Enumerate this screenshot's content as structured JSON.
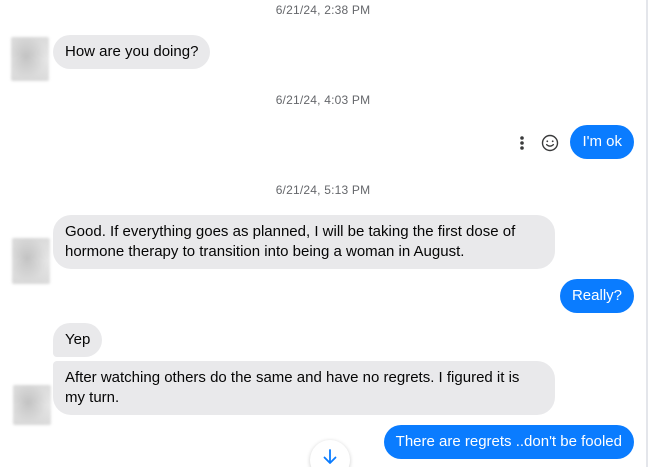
{
  "timestamps": [
    "6/21/24, 2:38 PM",
    "6/21/24, 4:03 PM",
    "6/21/24, 5:13 PM"
  ],
  "messages": {
    "m1": "How are you doing?",
    "m2": "I'm ok",
    "m3": "Good. If everything goes as planned, I will be taking the first dose of hormone therapy to transition into being a woman in August.",
    "m4": "Really?",
    "m5": "Yep",
    "m6": "After watching others do the same and have no regrets. I figured it is my turn.",
    "m7": "There are regrets ..don't be fooled"
  },
  "icons": {
    "more": "more-vertical-icon",
    "react": "smiley-icon",
    "scroll": "arrow-down-icon"
  },
  "colors": {
    "outgoing": "#0a7cff",
    "incoming": "#e9e9eb",
    "timestamp": "#65676b"
  }
}
